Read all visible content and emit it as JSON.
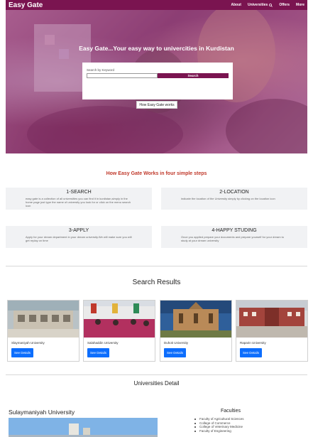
{
  "navbar": {
    "brand": "Easy Gate",
    "links": [
      "About",
      "Universities",
      "Offers",
      "More"
    ]
  },
  "hero": {
    "title": "Easy Gate...Your easy way to univercities in Kurdistan",
    "search_label": "Search by Keyword",
    "search_placeholder": "",
    "search_button": "Search",
    "how_button": "How Easy Gate works"
  },
  "steps": {
    "title": "How Easy Gate Works in four simple steps",
    "items": [
      {
        "title": "1-SEARCH",
        "desc": "easy gate is a collection of all universities you can find it in kurdistan,simply in the home page just type the name of university you look for or click on the menu search icon"
      },
      {
        "title": "2-LOCATION",
        "desc": "indicate the location of the University simply by clicking on the location icon"
      },
      {
        "title": "3-APPLY",
        "desc": "Apply for your dream department in your dream university.We will make sure you will get replay on time"
      },
      {
        "title": "4-HAPPY STUDING",
        "desc": "Once you applied prepare your documents and prepare yourself for your dream to study at your dream university"
      }
    ]
  },
  "results": {
    "title": "Search Results",
    "button_label": "See Details",
    "items": [
      {
        "name": "Slaymaniyah University"
      },
      {
        "name": "Salahaddin University"
      },
      {
        "name": "Duhok University"
      },
      {
        "name": "Raparin University"
      }
    ]
  },
  "detail": {
    "title": "Universities Detail",
    "university_name": "Sulaymaniyah University",
    "faculties_title": "Faculties",
    "faculties": [
      "Faculty of Agricultural Sciences",
      "College of Commerce",
      "College of Veterinary Medicine",
      "Faculty of Engineering"
    ]
  },
  "colors": {
    "brand": "#7a1450",
    "steps_title": "#c0392b",
    "button_blue": "#0d6efd"
  },
  "icons": {
    "nav_search": "search-icon"
  }
}
